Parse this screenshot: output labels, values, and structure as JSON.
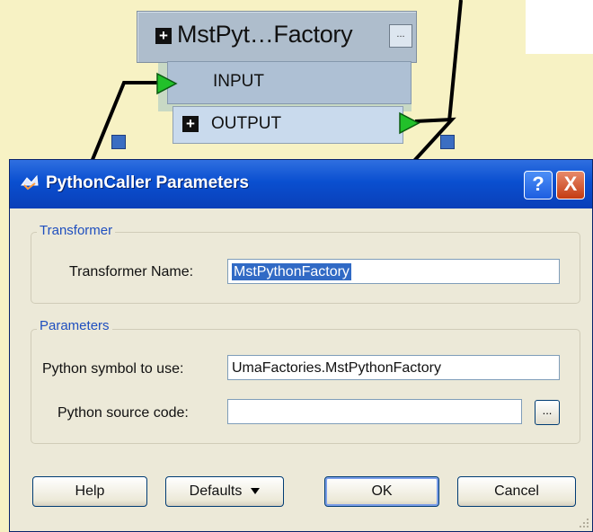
{
  "canvas": {
    "node": {
      "title": "MstPyt…Factory",
      "ellipsis_label": "...",
      "input_port": "INPUT",
      "output_port": "OUTPUT"
    }
  },
  "dialog": {
    "title": "PythonCaller Parameters",
    "help_button": "?",
    "close_button": "X",
    "transformer_group": {
      "label": "Transformer",
      "name_label": "Transformer Name:",
      "name_value": "MstPythonFactory"
    },
    "parameters_group": {
      "label": "Parameters",
      "symbol_label": "Python symbol to use:",
      "symbol_value": "UmaFactories.MstPythonFactory",
      "source_label": "Python source code:",
      "source_value": "",
      "browse_label": "..."
    },
    "buttons": {
      "help": "Help",
      "defaults": "Defaults",
      "ok": "OK",
      "cancel": "Cancel"
    }
  },
  "colors": {
    "canvas_bg": "#f7f2c4",
    "titlebar": "#0a4fd0",
    "group_label": "#1f4fbf",
    "port_arrow": "#22c02a"
  }
}
